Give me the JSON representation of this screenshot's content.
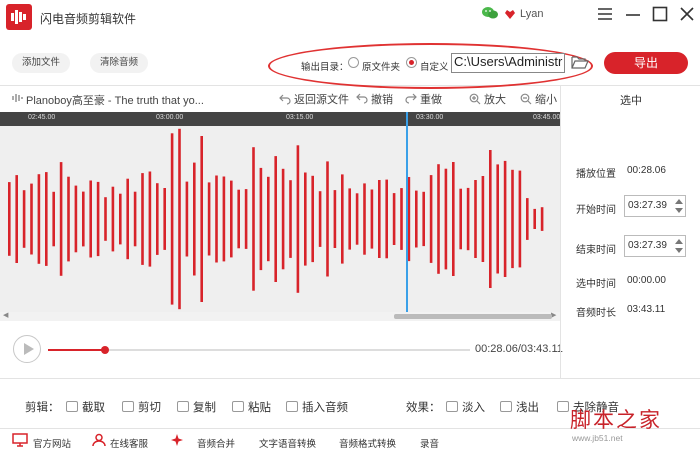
{
  "app": {
    "title": "闪电音频剪辑软件",
    "user": "Lyan",
    "brand_color": "#d8232a",
    "icons": {
      "logo": "lightning-logo-icon",
      "wechat": "wechat-icon",
      "user": "heart-badge-icon"
    }
  },
  "toolbar": {
    "add_file": "添加文件",
    "clear_audio": "清除音频",
    "output_dir_label": "输出目录：",
    "option_source": "原文件夹",
    "option_custom": "自定义",
    "selected_option": "custom",
    "output_path": "C:\\Users\\Administr",
    "export": "导出"
  },
  "filebar": {
    "file_name": "Planoboy高至豪 - The truth that yo...",
    "back_to_source": "返回源文件",
    "undo": "撤销",
    "redo": "重做",
    "zoom_in": "放大",
    "zoom_out": "缩小",
    "right_header": "选中"
  },
  "timeline": {
    "ticks": [
      "02:45.00",
      "03:00.00",
      "03:15.00",
      "03:30.00",
      "03:45.00"
    ],
    "waveform_color": "#d8232a",
    "playhead_color": "#3aa0e8"
  },
  "player": {
    "current": "00:28.06",
    "total": "03:43.11",
    "display": "00:28.06/03:43.11",
    "progress": 0.134
  },
  "panel": {
    "play_position_label": "播放位置",
    "play_position": "00:28.06",
    "start_label": "开始时间",
    "start": "03:27.39",
    "end_label": "结束时间",
    "end": "03:27.39",
    "selected_label": "选中时间",
    "selected": "00:00.00",
    "duration_label": "音频时长",
    "duration": "03:43.11"
  },
  "edit": {
    "label": "剪辑：",
    "crop": "截取",
    "cut": "剪切",
    "copy": "复制",
    "paste": "粘贴",
    "insert_audio": "插入音频",
    "effects_label": "效果：",
    "fade_in": "淡入",
    "fade_out": "浅出",
    "remove_silence": "去除静音"
  },
  "bottom_nav": {
    "website": "官方网站",
    "support": "在线客服",
    "merge": "音频合并",
    "tts": "文字语音转换",
    "format": "音频格式转换",
    "record": "录音"
  },
  "watermark": {
    "text": "脚本之家",
    "url": "www.jb51.net"
  }
}
